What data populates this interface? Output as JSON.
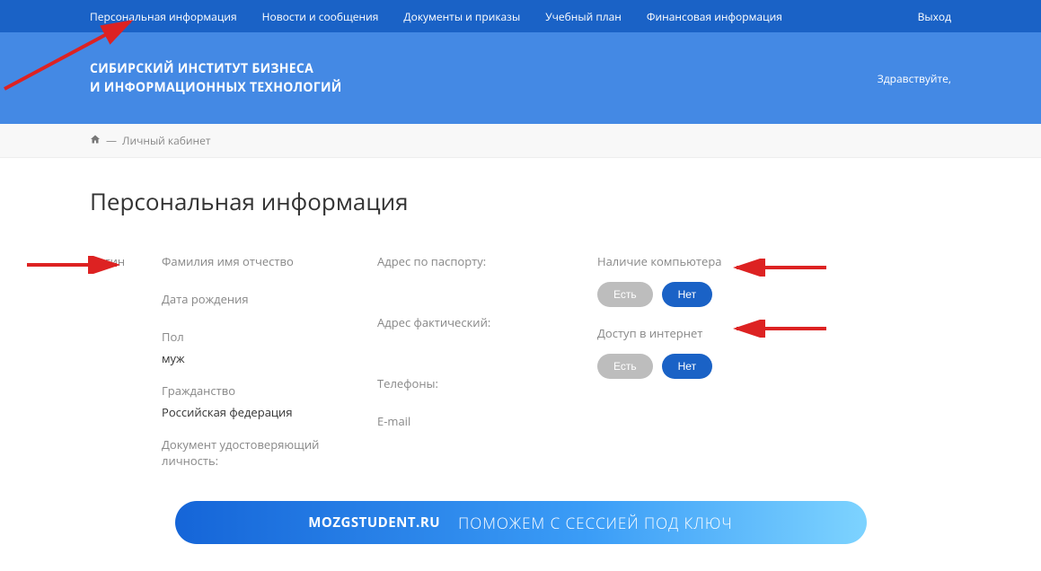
{
  "nav": {
    "items": [
      "Персональная информация",
      "Новости и сообщения",
      "Документы и приказы",
      "Учебный план",
      "Финансовая информация"
    ],
    "logout": "Выход"
  },
  "header": {
    "org_line1": "СИБИРСКИЙ ИНСТИТУТ БИЗНЕСА",
    "org_line2": "И ИНФОРМАЦИОННЫХ ТЕХНОЛОГИЙ",
    "greeting": "Здравствуйте,"
  },
  "breadcrumb": {
    "sep": "—",
    "current": "Личный кабинет"
  },
  "page": {
    "title": "Персональная информация"
  },
  "col1": {
    "login_label": "Логин"
  },
  "col2": {
    "fio_label": "Фамилия имя отчество",
    "dob_label": "Дата рождения",
    "gender_label": "Пол",
    "gender_value": "муж",
    "citizenship_label": "Гражданство",
    "citizenship_value": "Российская федерация",
    "doc_label": "Документ удостоверяющий личность:"
  },
  "col3": {
    "passport_addr_label": "Адрес по паспорту:",
    "actual_addr_label": "Адрес фактический:",
    "phones_label": "Телефоны:",
    "email_label": "E-mail"
  },
  "col4": {
    "computer_label": "Наличие компьютера",
    "internet_label": "Доступ в интернет",
    "yes": "Есть",
    "no": "Нет"
  },
  "banner": {
    "brand": "MOZGSTUDENT.RU",
    "text": "ПОМОЖЕМ С СЕССИЕЙ ПОД КЛЮЧ"
  }
}
